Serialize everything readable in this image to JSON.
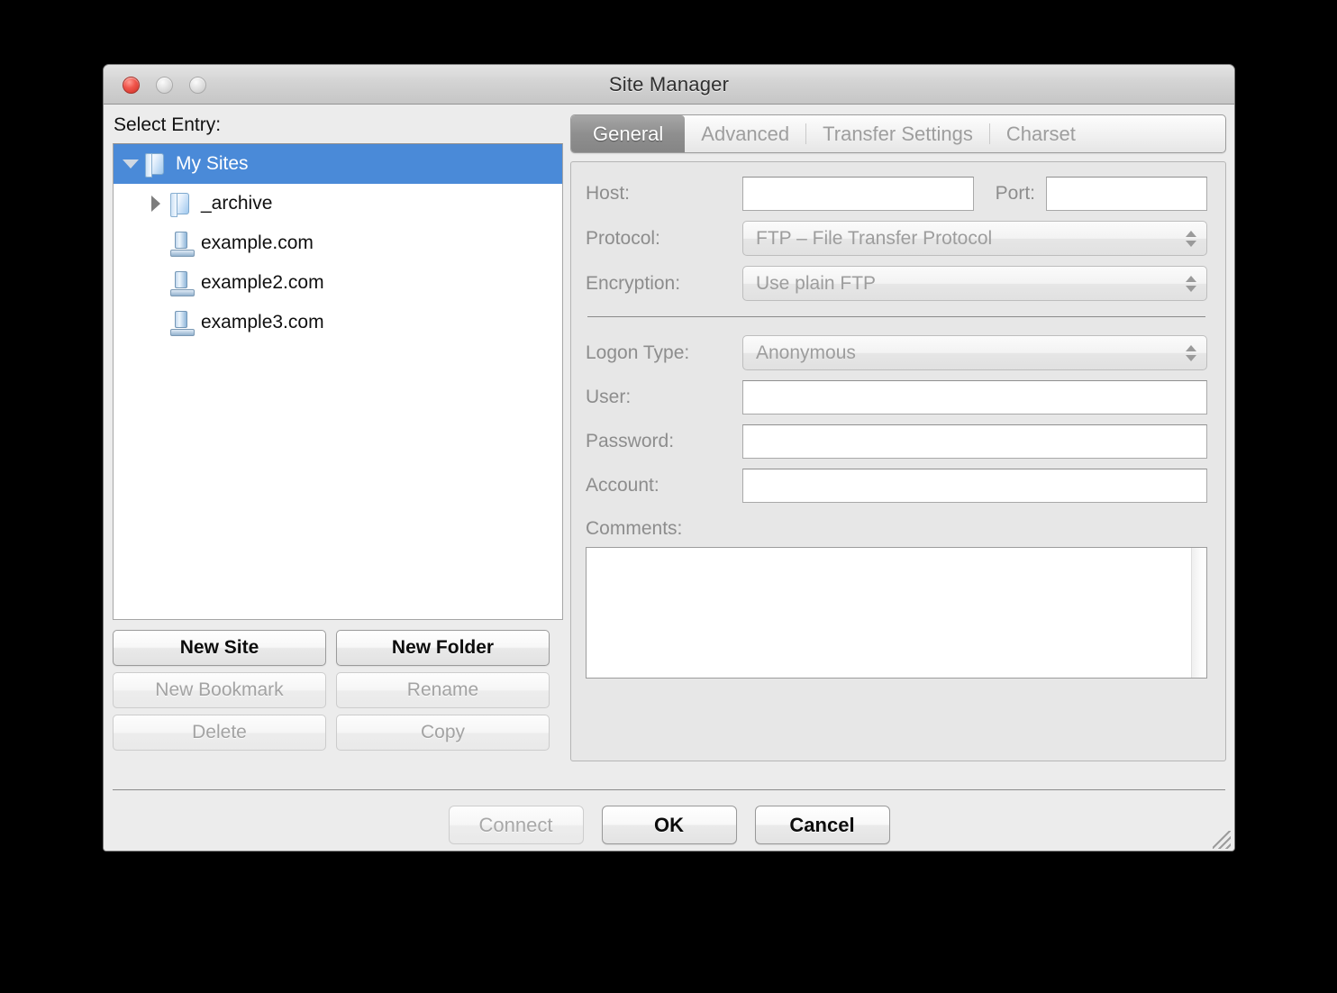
{
  "window": {
    "title": "Site Manager",
    "controls": {
      "close": "close-button",
      "minimize": "minimize-button",
      "zoom": "zoom-button"
    }
  },
  "left": {
    "select_entry_label": "Select Entry:",
    "tree": [
      {
        "label": "My Sites",
        "icon": "folder-icon",
        "twisty": "down",
        "depth": 0,
        "selected": true
      },
      {
        "label": "_archive",
        "icon": "folder-icon",
        "twisty": "right",
        "depth": 1,
        "selected": false
      },
      {
        "label": "example.com",
        "icon": "server-icon",
        "twisty": "none",
        "depth": 2,
        "selected": false
      },
      {
        "label": "example2.com",
        "icon": "server-icon",
        "twisty": "none",
        "depth": 2,
        "selected": false
      },
      {
        "label": "example3.com",
        "icon": "server-icon",
        "twisty": "none",
        "depth": 2,
        "selected": false
      }
    ],
    "buttons": [
      {
        "label": "New Site",
        "enabled": true
      },
      {
        "label": "New Folder",
        "enabled": true
      },
      {
        "label": "New Bookmark",
        "enabled": false
      },
      {
        "label": "Rename",
        "enabled": false
      },
      {
        "label": "Delete",
        "enabled": false
      },
      {
        "label": "Copy",
        "enabled": false
      }
    ]
  },
  "right": {
    "tabs": [
      {
        "label": "General",
        "active": true
      },
      {
        "label": "Advanced",
        "active": false
      },
      {
        "label": "Transfer Settings",
        "active": false
      },
      {
        "label": "Charset",
        "active": false
      }
    ],
    "fields": {
      "host_label": "Host:",
      "host_value": "",
      "port_label": "Port:",
      "port_value": "",
      "protocol_label": "Protocol:",
      "protocol_value": "FTP – File Transfer Protocol",
      "encryption_label": "Encryption:",
      "encryption_value": "Use plain FTP",
      "logon_type_label": "Logon Type:",
      "logon_type_value": "Anonymous",
      "user_label": "User:",
      "user_value": "",
      "password_label": "Password:",
      "password_value": "",
      "account_label": "Account:",
      "account_value": "",
      "comments_label": "Comments:",
      "comments_value": ""
    }
  },
  "bottom": {
    "buttons": [
      {
        "label": "Connect",
        "enabled": false
      },
      {
        "label": "OK",
        "enabled": true
      },
      {
        "label": "Cancel",
        "enabled": true
      }
    ]
  },
  "colors": {
    "selection_blue": "#4a8ad8",
    "window_bg": "#ececec",
    "panel_bg": "#e7e7e7",
    "disabled_text": "#a3a3a3",
    "label_text": "#8d8d8d",
    "close_red": "#f0564c"
  }
}
